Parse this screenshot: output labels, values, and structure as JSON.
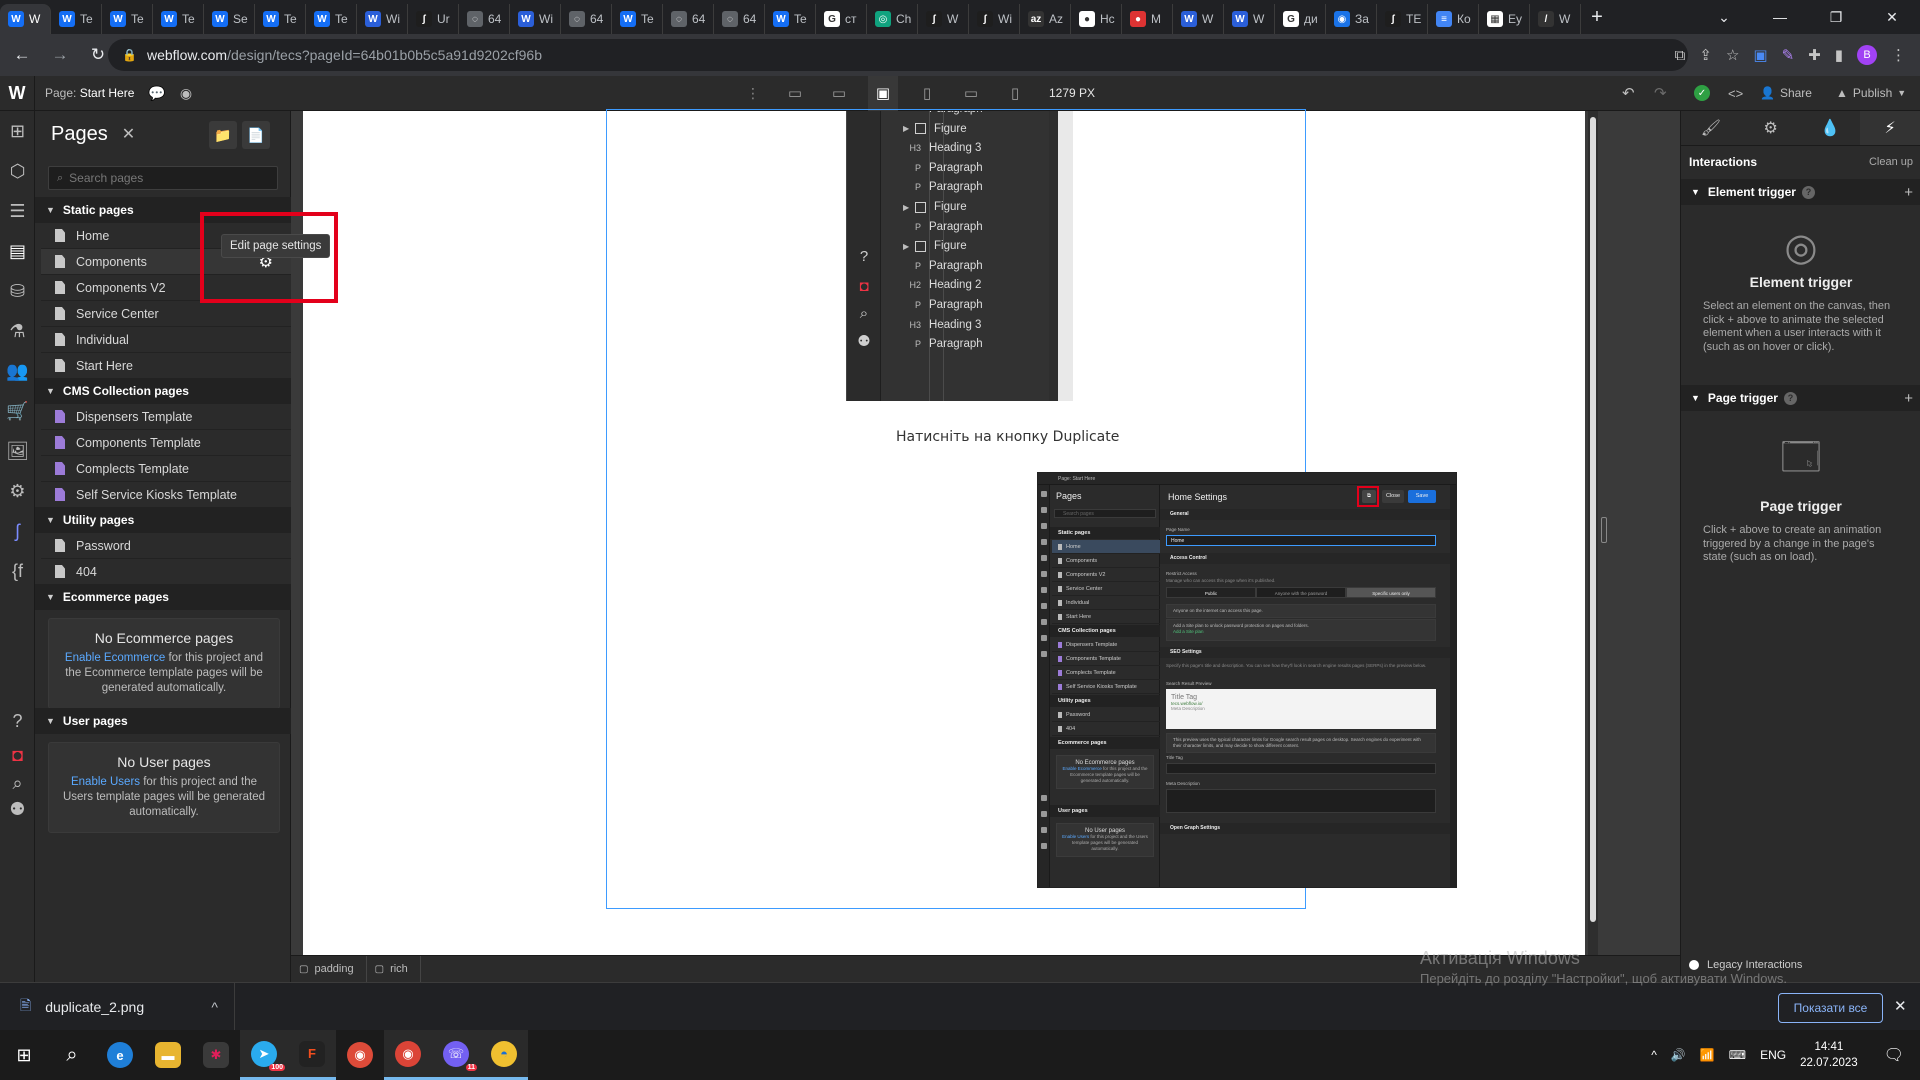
{
  "browser": {
    "tabs": [
      {
        "label": "W",
        "icon": "webflow"
      },
      {
        "label": "Te",
        "icon": "webflow"
      },
      {
        "label": "Te",
        "icon": "webflow"
      },
      {
        "label": "Te",
        "icon": "webflow"
      },
      {
        "label": "Se",
        "icon": "webflow"
      },
      {
        "label": "Te",
        "icon": "webflow"
      },
      {
        "label": "Te",
        "icon": "webflow"
      },
      {
        "label": "Wi",
        "icon": "webflow-blue"
      },
      {
        "label": "Ur",
        "icon": "figma"
      },
      {
        "label": "64",
        "icon": "globe"
      },
      {
        "label": "Wi",
        "icon": "webflow-blue"
      },
      {
        "label": "64",
        "icon": "globe"
      },
      {
        "label": "Te",
        "icon": "webflow"
      },
      {
        "label": "64",
        "icon": "globe"
      },
      {
        "label": "64",
        "icon": "globe"
      },
      {
        "label": "Te",
        "icon": "webflow"
      },
      {
        "label": "ст",
        "icon": "google"
      },
      {
        "label": "Ch",
        "icon": "chatgpt"
      },
      {
        "label": "W",
        "icon": "figma"
      },
      {
        "label": "Wi",
        "icon": "figma"
      },
      {
        "label": "Az",
        "icon": "az"
      },
      {
        "label": "Hc",
        "icon": "github"
      },
      {
        "label": "M",
        "icon": "record"
      },
      {
        "label": "W",
        "icon": "webflow-blue"
      },
      {
        "label": "W",
        "icon": "webflow-blue"
      },
      {
        "label": "ди",
        "icon": "google"
      },
      {
        "label": "За",
        "icon": "circle-blue"
      },
      {
        "label": "TE",
        "icon": "figma"
      },
      {
        "label": "Ко",
        "icon": "docs"
      },
      {
        "label": "Еу",
        "icon": "calendar"
      },
      {
        "label": "W",
        "icon": "slash"
      }
    ],
    "new_tab": "+",
    "url_host": "webflow.com",
    "url_path": "/design/tecs?pageId=64b01b0b5c5a91d9202cf96b",
    "profile_initial": "B"
  },
  "designer": {
    "page_label": "Page:",
    "page_name": "Start Here",
    "width_readout": "1279 PX",
    "share_label": "Share",
    "publish_label": "Publish"
  },
  "pages_panel": {
    "title": "Pages",
    "search_placeholder": "Search pages",
    "tooltip": "Edit page settings",
    "static_title": "Static pages",
    "static_pages": [
      "Home",
      "Components",
      "Components V2",
      "Service Center",
      "Individual",
      "Start Here"
    ],
    "cms_title": "CMS Collection pages",
    "cms_pages": [
      "Dispensers Template",
      "Components Template",
      "Complects Template",
      "Self Service Kiosks Template"
    ],
    "utility_title": "Utility pages",
    "utility_pages": [
      "Password",
      "404"
    ],
    "ecom_title": "Ecommerce pages",
    "ecom_empty_title": "No Ecommerce pages",
    "ecom_link": "Enable Ecommerce",
    "ecom_text": " for this project and the Ecommerce template pages will be generated automatically.",
    "user_title": "User pages",
    "user_empty_title": "No User pages",
    "user_link": "Enable Users",
    "user_text": " for this project and the Users template pages will be generated automatically."
  },
  "canvas": {
    "navigator_items": [
      {
        "tag": "",
        "label": "Paragraph",
        "kind": "p"
      },
      {
        "tag": "",
        "label": "Figure",
        "kind": "figure"
      },
      {
        "tag": "H3",
        "label": "Heading 3",
        "kind": "h"
      },
      {
        "tag": "P",
        "label": "Paragraph",
        "kind": "p"
      },
      {
        "tag": "P",
        "label": "Paragraph",
        "kind": "p"
      },
      {
        "tag": "",
        "label": "Figure",
        "kind": "figure"
      },
      {
        "tag": "P",
        "label": "Paragraph",
        "kind": "p"
      },
      {
        "tag": "",
        "label": "Figure",
        "kind": "figure"
      },
      {
        "tag": "P",
        "label": "Paragraph",
        "kind": "p"
      },
      {
        "tag": "H2",
        "label": "Heading 2",
        "kind": "h"
      },
      {
        "tag": "P",
        "label": "Paragraph",
        "kind": "p"
      },
      {
        "tag": "H3",
        "label": "Heading 3",
        "kind": "h"
      },
      {
        "tag": "P",
        "label": "Paragraph",
        "kind": "p"
      }
    ],
    "caption": "Натисніть на кнопку Duplicate",
    "settings_shot": {
      "top_page": "Page: Start Here",
      "pages_title": "Pages",
      "search": "Search pages",
      "static_title": "Static pages",
      "static": [
        "Home",
        "Components",
        "Components V2",
        "Service Center",
        "Individual",
        "Start Here"
      ],
      "cms_title": "CMS Collection pages",
      "cms": [
        "Dispensers Template",
        "Components Template",
        "Complects Template",
        "Self Service Kiosks Template"
      ],
      "utility_title": "Utility pages",
      "utility": [
        "Password",
        "404"
      ],
      "ecom_title": "Ecommerce pages",
      "ecom_box_title": "No Ecommerce pages",
      "ecom_box_link": "Enable Ecommerce",
      "ecom_box_text": " for this project and the Ecommerce template pages will be generated automatically.",
      "user_title": "User pages",
      "user_box_title": "No User pages",
      "user_box_link": "Enable Users",
      "user_box_text": " for this project and the Users template pages will be generated automatically.",
      "settings_title": "Home Settings",
      "close": "Close",
      "save": "Save",
      "general": "General",
      "page_name_label": "Page Name",
      "page_name_value": "Home",
      "access_control": "Access Control",
      "restrict_label": "Restrict Access",
      "restrict_desc": "Manage who can access this page when it's published.",
      "seg_public": "Public",
      "seg_password": "Anyone with the password",
      "seg_users": "Specific users only",
      "anyone_note": "Anyone on the internet can access this page.",
      "plan_note": "Add a Site plan to unlock password protection on pages and folders.",
      "plan_link": "Add a Site plan",
      "seo": "SEO Settings",
      "seo_desc": "Specify this page's title and description. You can see how they'll look in search engine results pages (SERPs) in the preview below.",
      "preview_label": "Search Result Preview",
      "serp_title": "Title Tag",
      "serp_url": "tecs.webflow.io/",
      "serp_desc": "Meta Description",
      "serp_note": "This preview uses the typical character limits for Google search result pages on desktop. Search engines do experiment with their character limits, and may decide to show different content.",
      "title_tag": "Title Tag",
      "meta_desc": "Meta Description",
      "og": "Open Graph Settings"
    }
  },
  "breadcrumbs": [
    "padding",
    "rich"
  ],
  "right_panel": {
    "heading": "Interactions",
    "cleanup": "Clean up",
    "element_section": "Element trigger",
    "element_title": "Element trigger",
    "element_desc": "Select an element on the canvas, then click + above to animate the selected element when a user interacts with it (such as on hover or click).",
    "page_section": "Page trigger",
    "page_title": "Page trigger",
    "page_desc": "Click + above to create an animation triggered by a change in the page's state (such as on load).",
    "legacy": "Legacy Interactions"
  },
  "watermark": {
    "line1": "Активація Windows",
    "line2": "Перейдіть до розділу \"Настройки\", щоб активувати Windows."
  },
  "downloads": {
    "file": "duplicate_2.png",
    "show_all": "Показати все"
  },
  "taskbar": {
    "lang": "ENG",
    "time": "14:41",
    "date": "22.07.2023",
    "telegram_badge": "100",
    "viber_badge": "11"
  },
  "colors": {
    "webflow_accent": "#3d9bff",
    "highlight_red": "#e3001b",
    "cms_purple": "#9c7bd8",
    "publish_green": "#2ea043"
  }
}
